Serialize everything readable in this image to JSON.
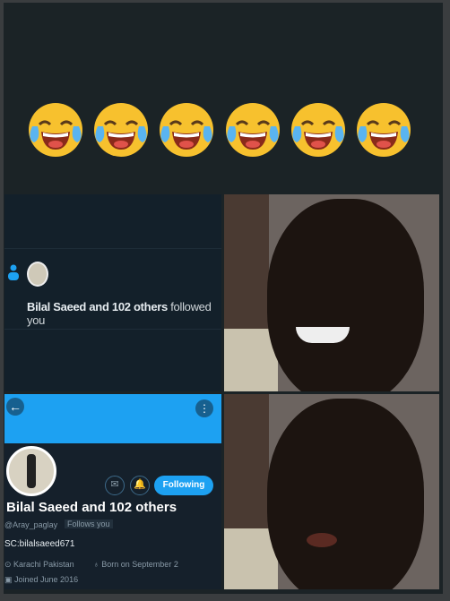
{
  "emojis": {
    "icon": "face-with-tears-of-joy-icon",
    "count": 6
  },
  "notification": {
    "name_text": "Bilal Saeed and 102 others",
    "action_text": "followed you"
  },
  "profile": {
    "name": "Bilal Saeed and 102 others",
    "handle": "@Aray_paglay",
    "follows_you": "Follows you",
    "bio": "SC:bilalsaeed671",
    "location": "Karachi Pakistan",
    "birthday": "Born on September 2",
    "joined": "Joined June 2016",
    "following_label": "Following"
  },
  "colors": {
    "accent": "#1da1f2",
    "background": "#15202b"
  }
}
